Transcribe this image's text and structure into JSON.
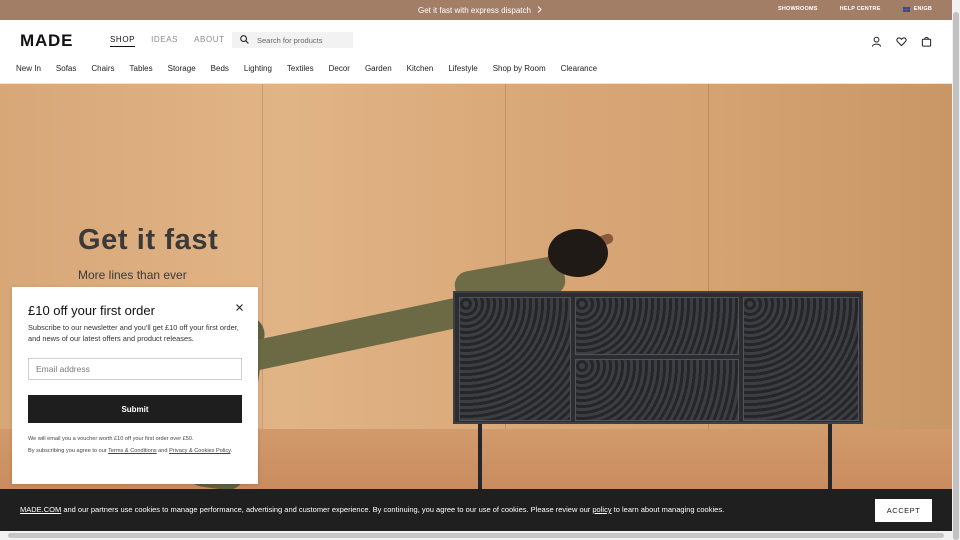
{
  "promo": {
    "message": "Get it fast with express dispatch",
    "links": [
      "SHOWROOMS",
      "HELP CENTRE"
    ],
    "language": "EN/GB"
  },
  "header": {
    "logo": "MADE",
    "main_nav": [
      {
        "label": "SHOP",
        "active": true
      },
      {
        "label": "IDEAS",
        "active": false
      },
      {
        "label": "ABOUT",
        "active": false
      }
    ],
    "search_placeholder": "Search for products",
    "icons": [
      "account-icon",
      "wishlist-heart-icon",
      "basket-icon"
    ]
  },
  "categories": [
    "New In",
    "Sofas",
    "Chairs",
    "Tables",
    "Storage",
    "Beds",
    "Lighting",
    "Textiles",
    "Decor",
    "Garden",
    "Kitchen",
    "Lifestyle",
    "Shop by Room",
    "Clearance"
  ],
  "hero": {
    "title": "Get it fast",
    "subtitle": "More lines than ever"
  },
  "modal": {
    "title": "£10 off your first order",
    "intro": "Subscribe to our newsletter and you'll get £10 off your first order, and news of our latest offers and product releases.",
    "email_placeholder": "Email address",
    "submit_label": "Submit",
    "fine_line1": "We will email you a voucher worth £10 off your first order over £50.",
    "fine_line2_pre": "By subscribing you agree to our ",
    "terms_link": "Terms & Conditions",
    "fine_and": " and ",
    "privacy_link": "Privacy & Cookies Policy",
    "fine_end": "."
  },
  "cookie": {
    "site_link": "MADE.COM",
    "text_before": " and our partners use cookies to manage performance, advertising and customer experience. By continuing, you agree to our use of cookies. Please review our ",
    "policy_link": "policy",
    "text_after": " to learn about managing cookies.",
    "accept_label": "ACCEPT"
  },
  "colors": {
    "promo_bar": "#a27e67",
    "cookie_bar": "#1f1f1f",
    "submit_button": "#1e1e1e"
  }
}
